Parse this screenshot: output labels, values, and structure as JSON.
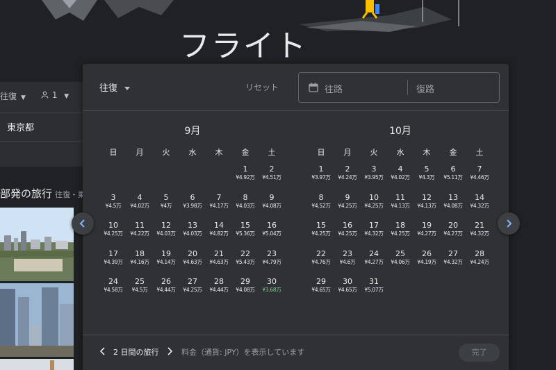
{
  "page": {
    "title": "フライト"
  },
  "background": {
    "trip_type": "往復",
    "passengers": "1",
    "origin": "東京都",
    "section_title": "部発の旅行",
    "section_sub": "往復・乗客"
  },
  "dialog": {
    "trip_type": "往復",
    "reset_label": "リセット",
    "depart_placeholder": "往路",
    "return_placeholder": "復路",
    "weekdays": [
      "日",
      "月",
      "火",
      "水",
      "木",
      "金",
      "土"
    ],
    "months": [
      {
        "title": "9月",
        "offset": 5,
        "days": [
          {
            "d": "1",
            "p": "¥4.92万"
          },
          {
            "d": "2",
            "p": "¥4.51万"
          },
          {
            "d": "3",
            "p": "¥4.5万"
          },
          {
            "d": "4",
            "p": "¥4.02万"
          },
          {
            "d": "5",
            "p": "¥4万"
          },
          {
            "d": "6",
            "p": "¥3.98万"
          },
          {
            "d": "7",
            "p": "¥4.17万"
          },
          {
            "d": "8",
            "p": "¥4.03万"
          },
          {
            "d": "9",
            "p": "¥4.08万"
          },
          {
            "d": "10",
            "p": "¥4.25万"
          },
          {
            "d": "11",
            "p": "¥4.22万"
          },
          {
            "d": "12",
            "p": "¥4.03万"
          },
          {
            "d": "13",
            "p": "¥4.03万"
          },
          {
            "d": "14",
            "p": "¥4.82万"
          },
          {
            "d": "15",
            "p": "¥5.36万"
          },
          {
            "d": "16",
            "p": "¥5.04万"
          },
          {
            "d": "17",
            "p": "¥4.39万"
          },
          {
            "d": "18",
            "p": "¥4.16万"
          },
          {
            "d": "19",
            "p": "¥4.14万"
          },
          {
            "d": "20",
            "p": "¥4.63万"
          },
          {
            "d": "21",
            "p": "¥4.63万"
          },
          {
            "d": "22",
            "p": "¥5.43万"
          },
          {
            "d": "23",
            "p": "¥4.79万"
          },
          {
            "d": "24",
            "p": "¥4.58万"
          },
          {
            "d": "25",
            "p": "¥4.5万"
          },
          {
            "d": "26",
            "p": "¥4.44万"
          },
          {
            "d": "27",
            "p": "¥4.25万"
          },
          {
            "d": "28",
            "p": "¥4.44万"
          },
          {
            "d": "29",
            "p": "¥4.08万"
          },
          {
            "d": "30",
            "p": "¥3.68万",
            "cheap": true
          }
        ]
      },
      {
        "title": "10月",
        "offset": 0,
        "days": [
          {
            "d": "1",
            "p": "¥3.97万"
          },
          {
            "d": "2",
            "p": "¥4.24万"
          },
          {
            "d": "3",
            "p": "¥3.95万"
          },
          {
            "d": "4",
            "p": "¥4.02万"
          },
          {
            "d": "5",
            "p": "¥4.3万"
          },
          {
            "d": "6",
            "p": "¥5.11万"
          },
          {
            "d": "7",
            "p": "¥4.46万"
          },
          {
            "d": "8",
            "p": "¥4.52万"
          },
          {
            "d": "9",
            "p": "¥4.25万"
          },
          {
            "d": "10",
            "p": "¥4.25万"
          },
          {
            "d": "11",
            "p": "¥4.13万"
          },
          {
            "d": "12",
            "p": "¥4.13万"
          },
          {
            "d": "13",
            "p": "¥4.08万"
          },
          {
            "d": "14",
            "p": "¥4.32万"
          },
          {
            "d": "15",
            "p": "¥4.25万"
          },
          {
            "d": "16",
            "p": "¥4.25万"
          },
          {
            "d": "17",
            "p": "¥4.32万"
          },
          {
            "d": "18",
            "p": "¥4.25万"
          },
          {
            "d": "19",
            "p": "¥4.27万"
          },
          {
            "d": "20",
            "p": "¥4.27万"
          },
          {
            "d": "21",
            "p": "¥4.32万"
          },
          {
            "d": "22",
            "p": "¥4.76万"
          },
          {
            "d": "23",
            "p": "¥4.6万"
          },
          {
            "d": "24",
            "p": "¥4.27万"
          },
          {
            "d": "25",
            "p": "¥4.06万"
          },
          {
            "d": "26",
            "p": "¥4.19万"
          },
          {
            "d": "27",
            "p": "¥4.32万"
          },
          {
            "d": "28",
            "p": "¥4.24万"
          },
          {
            "d": "29",
            "p": "¥4.65万"
          },
          {
            "d": "30",
            "p": "¥4.65万"
          },
          {
            "d": "31",
            "p": "¥5.07万"
          }
        ]
      }
    ],
    "footer": {
      "trip_length": "2 日間の旅行",
      "price_note": "料金（通貨: JPY）を表示しています",
      "done_label": "完了"
    }
  },
  "colors": {
    "accent_green": "#81c995",
    "dialog_bg": "#303134",
    "page_bg": "#202124"
  },
  "icons": [
    "calendar-icon",
    "chevron-left-icon",
    "chevron-right-icon",
    "person-icon",
    "caret-down-icon"
  ]
}
